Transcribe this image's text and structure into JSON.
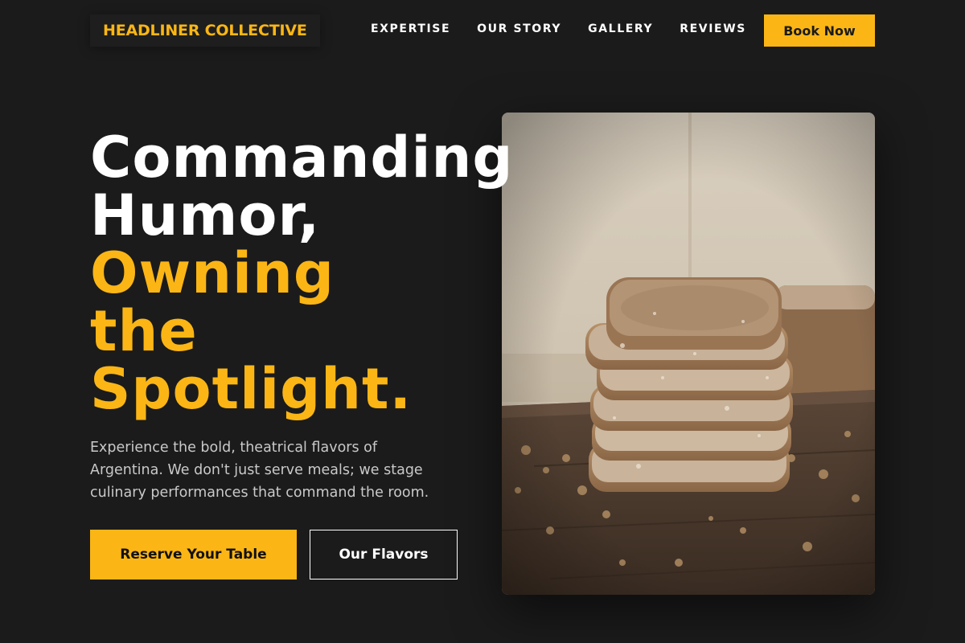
{
  "header": {
    "brand": "HEADLINER COLLECTIVE",
    "nav": [
      {
        "label": "EXPERTISE"
      },
      {
        "label": "OUR STORY"
      },
      {
        "label": "GALLERY"
      },
      {
        "label": "REVIEWS"
      }
    ],
    "book_label": "Book Now"
  },
  "hero": {
    "headline_lines": [
      {
        "text": "Commanding",
        "tone": "white"
      },
      {
        "text": "Humor,",
        "tone": "white"
      },
      {
        "text": "Owning",
        "tone": "gold"
      },
      {
        "text": "the",
        "tone": "gold"
      },
      {
        "text": "Spotlight.",
        "tone": "gold"
      }
    ],
    "description": "Experience the bold, theatrical flavors of Argentina. We don't just serve meals; we stage culinary performances that command the room.",
    "primary_cta": "Reserve Your Table",
    "secondary_cta": "Our Flavors",
    "image_subject": "stack-of-sliced-rustic-bread"
  },
  "colors": {
    "background": "#1b1b1b",
    "accent": "#fbb615",
    "text": "#ffffff",
    "muted_text": "#c9c9c9"
  }
}
